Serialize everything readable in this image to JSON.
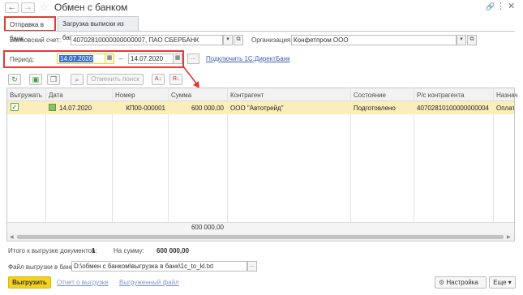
{
  "window": {
    "title": "Обмен с банком"
  },
  "tabs": [
    {
      "label": "Отправка в банк"
    },
    {
      "label": "Загрузка выписки из банка"
    }
  ],
  "account": {
    "label": "Банковский счет:",
    "value": "40702810000000000007, ПАО СБЕРБАНК"
  },
  "organization": {
    "label": "Организация:",
    "value": "Конфетпром ООО"
  },
  "period": {
    "label": "Период:",
    "from": "14.07.2020",
    "dash": "–",
    "to": "14.07.2020",
    "more": "...",
    "connect_link": "Подключить 1С:ДиректБанк"
  },
  "toolbar": {
    "cancel_search": "Отменить поиск"
  },
  "table": {
    "columns": [
      "Выгружать",
      "Дата",
      "Номер",
      "Сумма",
      "Контрагент",
      "Состояние",
      "Р/с контрагента",
      "Назнач"
    ],
    "rows": [
      {
        "checked": true,
        "date": "14.07.2020",
        "number": "КП00-000001",
        "amount": "600 000,00",
        "counterparty": "ООО \"Автотрейд\"",
        "state": "Подготовлено",
        "account": "40702810100000000004",
        "purpose": "Оплата"
      }
    ],
    "total": "600 000,00"
  },
  "summary": {
    "docs_label": "Итого к выгрузке документов:",
    "docs_count": "1",
    "sum_label": "На сумму:",
    "sum_value": "600 000,00"
  },
  "file": {
    "label": "Файл выгрузки в банк:",
    "path": "D:\\обмен с банком\\выгрузка в банк\\1c_to_kl.txt",
    "more": "..."
  },
  "footer": {
    "export_button": "Выгрузить",
    "report_link": "Отчет о выгрузке",
    "file_link": "Выгруженный файл",
    "settings_button": "Настройка",
    "more_button": "Еще"
  },
  "colors": {
    "accent_yellow": "#f5d31c",
    "row_highlight": "#fbeebb",
    "highlight_red": "#e53935",
    "link_blue": "#3c5fb4"
  }
}
